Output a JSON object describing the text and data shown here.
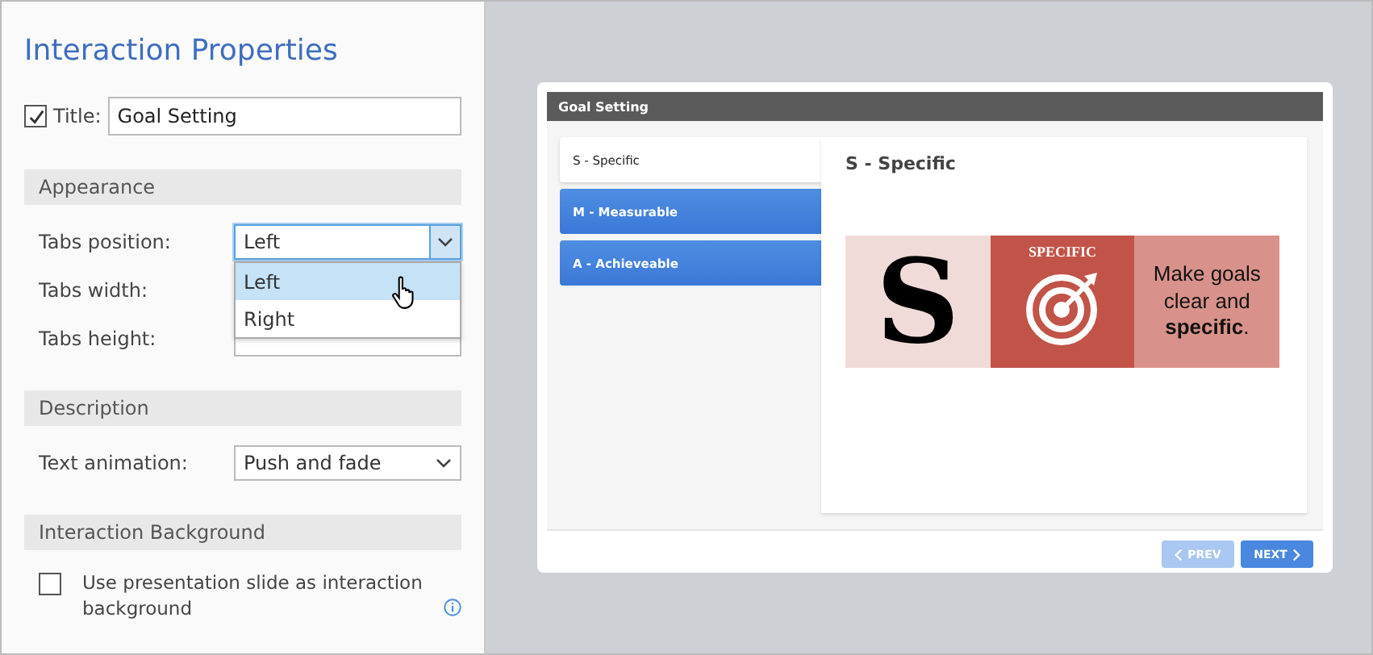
{
  "panel": {
    "heading": "Interaction Properties",
    "title_checkbox": {
      "checked": true,
      "label": "Title:"
    },
    "title_value": "Goal Setting",
    "sections": [
      {
        "heading": "Appearance",
        "rows": [
          {
            "label": "Tabs position:",
            "kind": "dropdown",
            "value": "Left",
            "open": true,
            "options": [
              {
                "label": "Left",
                "selected": true
              },
              {
                "label": "Right",
                "selected": false
              }
            ]
          },
          {
            "label": "Tabs width:",
            "kind": "hidden"
          },
          {
            "label": "Tabs height:",
            "kind": "covered"
          }
        ]
      },
      {
        "heading": "Description",
        "rows": [
          {
            "label": "Text animation:",
            "kind": "dropdown",
            "value": "Push and fade",
            "open": false
          }
        ]
      },
      {
        "heading": "Interaction Background",
        "rows": [
          {
            "label": "Use presentation slide as interaction background",
            "kind": "checkbox",
            "checked": false
          }
        ]
      }
    ]
  },
  "preview": {
    "title": "Goal Setting",
    "tabs": [
      {
        "label": "S - Specific",
        "selected": true
      },
      {
        "label": "M - Measurable",
        "selected": false
      },
      {
        "label": "A - Achieveable",
        "selected": false
      }
    ],
    "content_heading": "S - Specific",
    "banner": {
      "letter": "S",
      "caption": "SPECIFIC",
      "text": "Make goals clear and **specific**."
    },
    "buttons": [
      {
        "label": "PREV",
        "disabled": true,
        "kind": "prev"
      },
      {
        "label": "NEXT",
        "disabled": false,
        "kind": "next"
      }
    ]
  }
}
